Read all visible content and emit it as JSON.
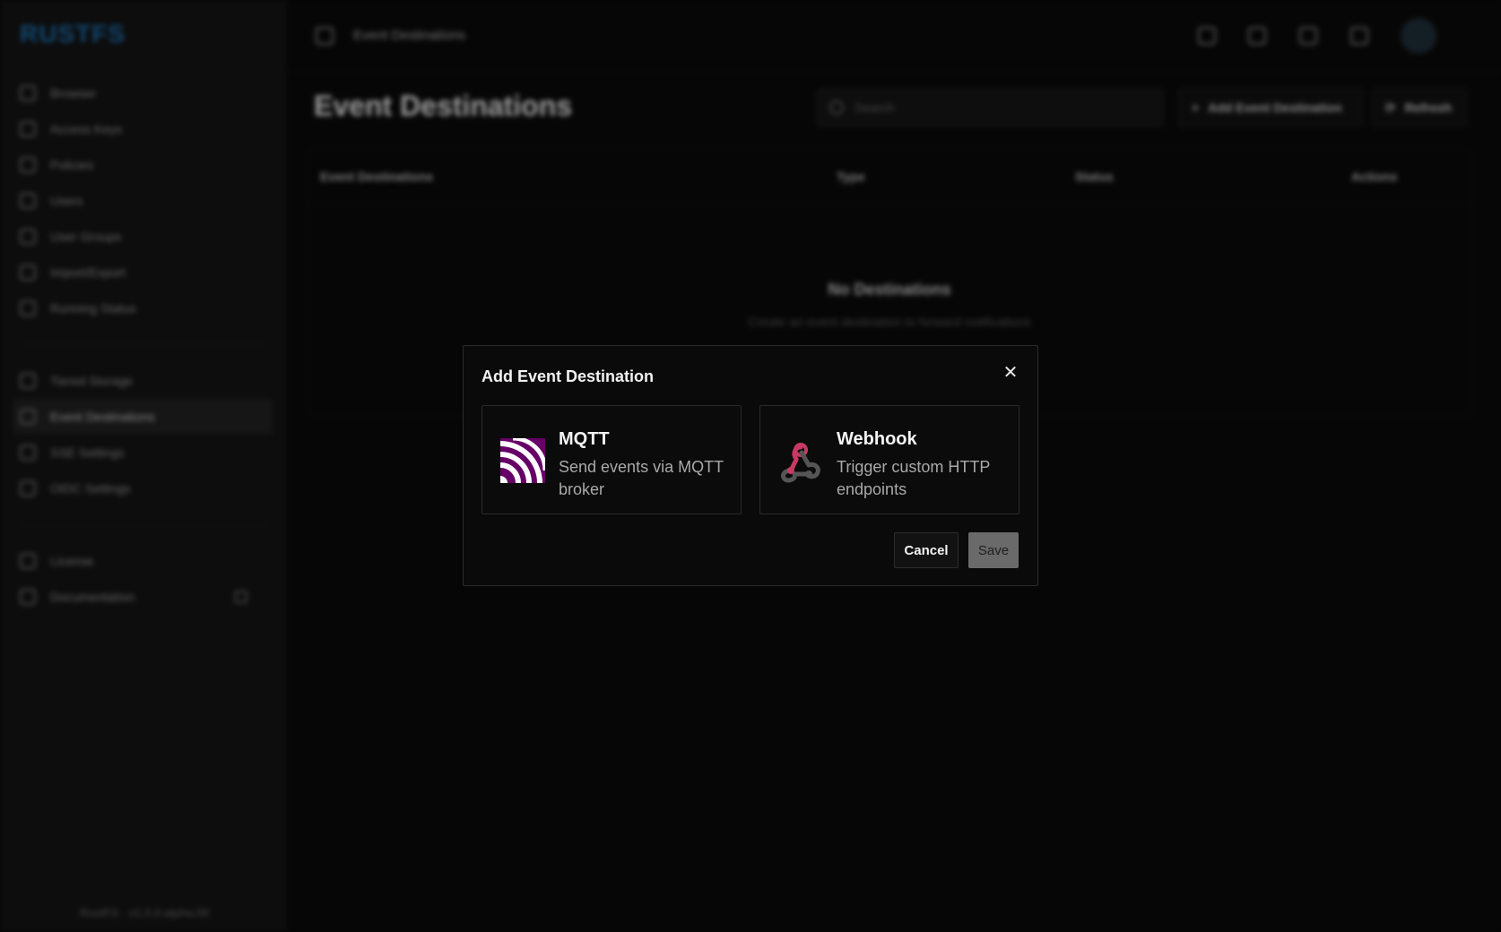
{
  "app": {
    "logo": "RUSTFS",
    "version": "RustFS · v1.0.0-alpha.58"
  },
  "sidebar": {
    "items": [
      {
        "label": "Browser"
      },
      {
        "label": "Access Keys"
      },
      {
        "label": "Policies"
      },
      {
        "label": "Users"
      },
      {
        "label": "User Groups"
      },
      {
        "label": "Import/Export"
      },
      {
        "label": "Running Status"
      },
      {
        "label": "Tiered Storage"
      },
      {
        "label": "Event Destinations"
      },
      {
        "label": "SSE Settings"
      },
      {
        "label": "OIDC Settings"
      },
      {
        "label": "License"
      },
      {
        "label": "Documentation"
      }
    ]
  },
  "header": {
    "breadcrumb": "Event Destinations",
    "avatar": "user"
  },
  "page": {
    "title": "Event Destinations",
    "search_placeholder": "Search",
    "add_button": "Add Event Destination",
    "refresh_button": "Refresh",
    "table": {
      "columns": [
        "Event Destinations",
        "Type",
        "Status",
        "Actions"
      ],
      "empty_title": "No Destinations",
      "empty_subtitle": "Create an event destination to forward notifications"
    }
  },
  "modal": {
    "title": "Add Event Destination",
    "close_glyph": "✕",
    "options": [
      {
        "name": "MQTT",
        "description": "Send events via MQTT broker",
        "icon": "mqtt-icon",
        "color": "#660066"
      },
      {
        "name": "Webhook",
        "description": "Trigger custom HTTP endpoints",
        "icon": "webhook-icon",
        "color": "#c73a63"
      }
    ],
    "cancel_label": "Cancel",
    "save_label": "Save"
  }
}
